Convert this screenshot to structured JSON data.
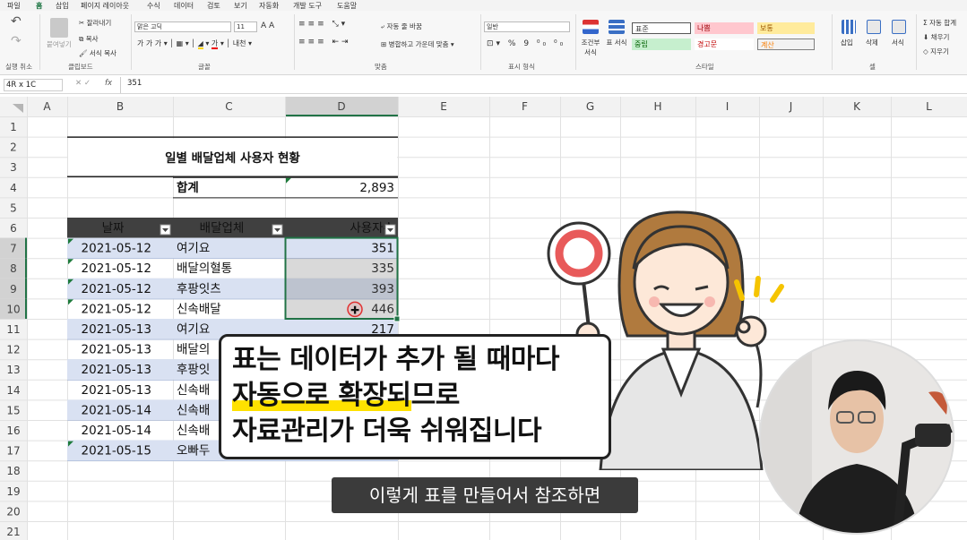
{
  "tabs": [
    "파일",
    "홈",
    "삽입",
    "페이지 레이아웃",
    "수식",
    "데이터",
    "검토",
    "보기",
    "자동화",
    "개발 도구",
    "도움말"
  ],
  "ribbon": {
    "undo_group": "실행 취소",
    "clipboard": {
      "paste": "붙여넣기",
      "cut": "잘라내기",
      "copy": "복사",
      "format_painter": "서식 복사",
      "label": "클립보드"
    },
    "font": {
      "name": "맑은 고딕",
      "size": "11",
      "label": "글꼴"
    },
    "alignment": {
      "wrap": "자동 줄 바꿈",
      "merge": "병합하고 가운데 맞춤",
      "label": "맞춤"
    },
    "number": {
      "format": "일반",
      "label": "표시 형식"
    },
    "styles": {
      "conditional": "조건부 서식",
      "table": "표 서식",
      "normal": "표준",
      "bad": "나쁨",
      "good": "보통",
      "neutral": "중립",
      "warning": "경고문",
      "calc": "계산",
      "label": "스타일"
    },
    "cells": {
      "insert": "삽입",
      "delete": "삭제",
      "format": "서식",
      "label": "셀"
    },
    "editing": {
      "autosum": "자동 합계",
      "fill": "채우기",
      "clear": "지우기"
    }
  },
  "formula_bar": {
    "name_box": "4R x 1C",
    "fx": "fx",
    "value": "351"
  },
  "columns": [
    "A",
    "B",
    "C",
    "D",
    "E",
    "F",
    "G",
    "H",
    "I",
    "J",
    "K",
    "L"
  ],
  "rows": [
    "1",
    "2",
    "3",
    "4",
    "5",
    "6",
    "7",
    "8",
    "9",
    "10",
    "11",
    "12",
    "13",
    "14",
    "15",
    "16",
    "17",
    "18",
    "19",
    "20",
    "21"
  ],
  "sheet": {
    "title": "일별 배달업체 사용자 현황",
    "total_label": "합계",
    "total_value": "2,893",
    "headers": [
      "날짜",
      "배달업체",
      "사용자수"
    ],
    "data": [
      [
        "2021-05-12",
        "여기요",
        "351"
      ],
      [
        "2021-05-12",
        "배달의혈통",
        "335"
      ],
      [
        "2021-05-12",
        "후팡잇츠",
        "393"
      ],
      [
        "2021-05-12",
        "신속배달",
        "446"
      ],
      [
        "2021-05-13",
        "여기요",
        "217"
      ],
      [
        "2021-05-13",
        "배달의",
        ""
      ],
      [
        "2021-05-13",
        "후팡잇",
        ""
      ],
      [
        "2021-05-13",
        "신속배",
        ""
      ],
      [
        "2021-05-14",
        "신속배",
        ""
      ],
      [
        "2021-05-14",
        "신속배",
        ""
      ],
      [
        "2021-05-15",
        "오빠두",
        ""
      ]
    ]
  },
  "overlay": {
    "lines": [
      "표는 데이터가 추가 될 때마다",
      "자동으로 확장되므로",
      "자료관리가 더욱 쉬워집니다"
    ],
    "subtitle": "이렇게 표를 만들어서 참조하면"
  },
  "colors": {
    "header_dark": "#404040",
    "band": "#d9e1f2",
    "selection": "#217346",
    "highlight": "#ffe100"
  }
}
